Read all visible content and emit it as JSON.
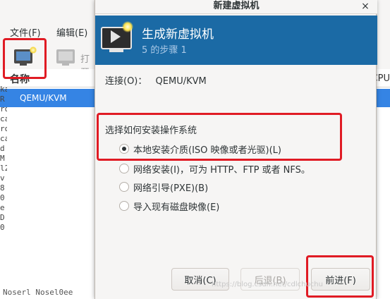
{
  "background_window": {
    "menu": [
      "文件(F)",
      "编辑(E)"
    ],
    "toolbar_open_label": "打开",
    "list": {
      "column_name": "名称",
      "column_cpu": "CPU",
      "selected_row": "QEMU/KVM"
    },
    "left_sliver_text": [
      "ka",
      "R",
      "ro",
      "ca",
      "ro",
      "ca",
      "d",
      "M",
      "l2",
      "v",
      "8",
      "0",
      "e",
      "D",
      "0"
    ],
    "bottom_text": "Noserl  Nosel0ee"
  },
  "dialog": {
    "title": "新建虚拟机",
    "close_glyph": "×",
    "banner": {
      "title": "生成新虚拟机",
      "step": "5 的步骤 1"
    },
    "connection": {
      "label": "连接(O)：",
      "value": "QEMU/KVM"
    },
    "install_section": {
      "title": "选择如何安装操作系统",
      "options": [
        {
          "label": "本地安装介质(ISO 映像或者光驱)(L)",
          "checked": true
        },
        {
          "label": "网络安装(I)，可为 HTTP、FTP 或者 NFS。",
          "checked": false
        },
        {
          "label": "网络引导(PXE)(B)",
          "checked": false
        },
        {
          "label": "导入现有磁盘映像(E)",
          "checked": false
        }
      ]
    },
    "buttons": {
      "cancel": "取消(C)",
      "back": "后退(B)",
      "forward": "前进(F)"
    }
  },
  "watermark": "https://blog.csdn.net/cdlchuchu",
  "colors": {
    "banner_bg": "#1b6aa5",
    "selection_bg": "#3584e4",
    "highlight_red": "#e01b24"
  }
}
